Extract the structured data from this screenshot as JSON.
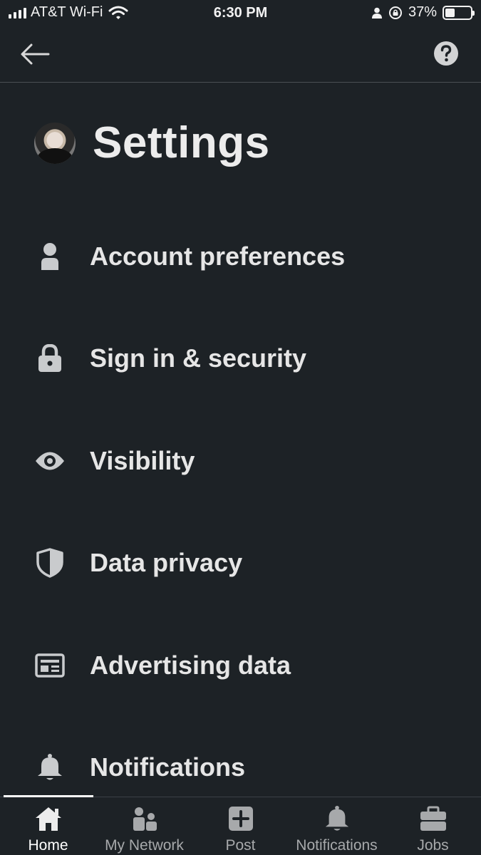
{
  "status_bar": {
    "carrier": "AT&T Wi-Fi",
    "time": "6:30 PM",
    "battery_percent": "37%",
    "battery_level": 0.37
  },
  "top_nav": {
    "back_icon": "arrow-left-icon",
    "help_icon": "question-circle-icon"
  },
  "header": {
    "title": "Settings"
  },
  "menu": {
    "items": [
      {
        "label": "Account preferences",
        "icon": "person-icon"
      },
      {
        "label": "Sign in & security",
        "icon": "lock-icon"
      },
      {
        "label": "Visibility",
        "icon": "eye-icon"
      },
      {
        "label": "Data privacy",
        "icon": "shield-icon"
      },
      {
        "label": "Advertising data",
        "icon": "newspaper-icon"
      },
      {
        "label": "Notifications",
        "icon": "bell-icon"
      }
    ]
  },
  "tab_bar": {
    "active": "Home",
    "tabs": [
      {
        "label": "Home",
        "icon": "home-icon"
      },
      {
        "label": "My Network",
        "icon": "people-icon"
      },
      {
        "label": "Post",
        "icon": "plus-square-icon"
      },
      {
        "label": "Notifications",
        "icon": "bell-icon"
      },
      {
        "label": "Jobs",
        "icon": "briefcase-icon"
      }
    ]
  },
  "colors": {
    "background": "#1d2226",
    "text": "#e6e6e6",
    "icon": "#c9cbcd",
    "inactive_tab": "#a7a9ab"
  }
}
